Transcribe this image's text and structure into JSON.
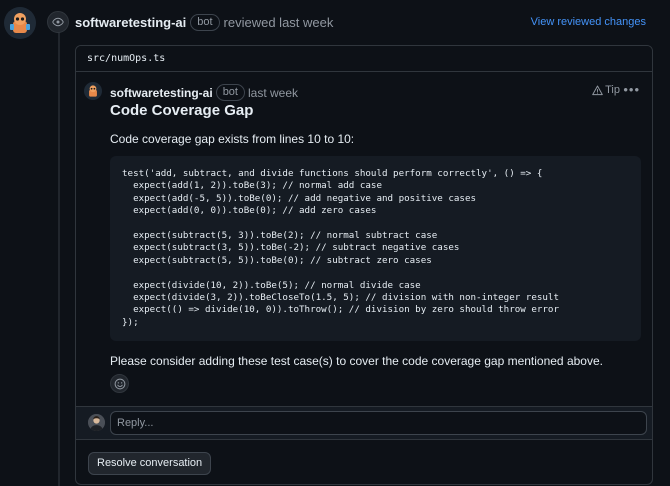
{
  "review": {
    "author": "softwaretesting-ai",
    "bot_badge": "bot",
    "action_text": "reviewed last week",
    "view_changes": "View reviewed changes"
  },
  "file": {
    "path": "src/numOps.ts"
  },
  "comment": {
    "author": "softwaretesting-ai",
    "bot_badge": "bot",
    "timestamp": "last week",
    "tip_label": "Tip",
    "title": "Code Coverage Gap",
    "intro": "Code coverage gap exists from lines 10 to 10:",
    "code": "test('add, subtract, and divide functions should perform correctly', () => {\n  expect(add(1, 2)).toBe(3); // normal add case\n  expect(add(-5, 5)).toBe(0); // add negative and positive cases\n  expect(add(0, 0)).toBe(0); // add zero cases\n\n  expect(subtract(5, 3)).toBe(2); // normal subtract case\n  expect(subtract(3, 5)).toBe(-2); // subtract negative cases\n  expect(subtract(5, 5)).toBe(0); // subtract zero cases\n\n  expect(divide(10, 2)).toBe(5); // normal divide case\n  expect(divide(3, 2)).toBeCloseTo(1.5, 5); // division with non-integer result\n  expect(() => divide(10, 0)).toThrow(); // division by zero should throw error\n});",
    "closing": "Please consider adding these test case(s) to cover the code coverage gap mentioned above."
  },
  "reply": {
    "placeholder": "Reply..."
  },
  "actions": {
    "resolve": "Resolve conversation"
  },
  "colors": {
    "background": "#0d1117",
    "link": "#4493f8",
    "border": "#30363d",
    "muted": "#9198a1"
  }
}
